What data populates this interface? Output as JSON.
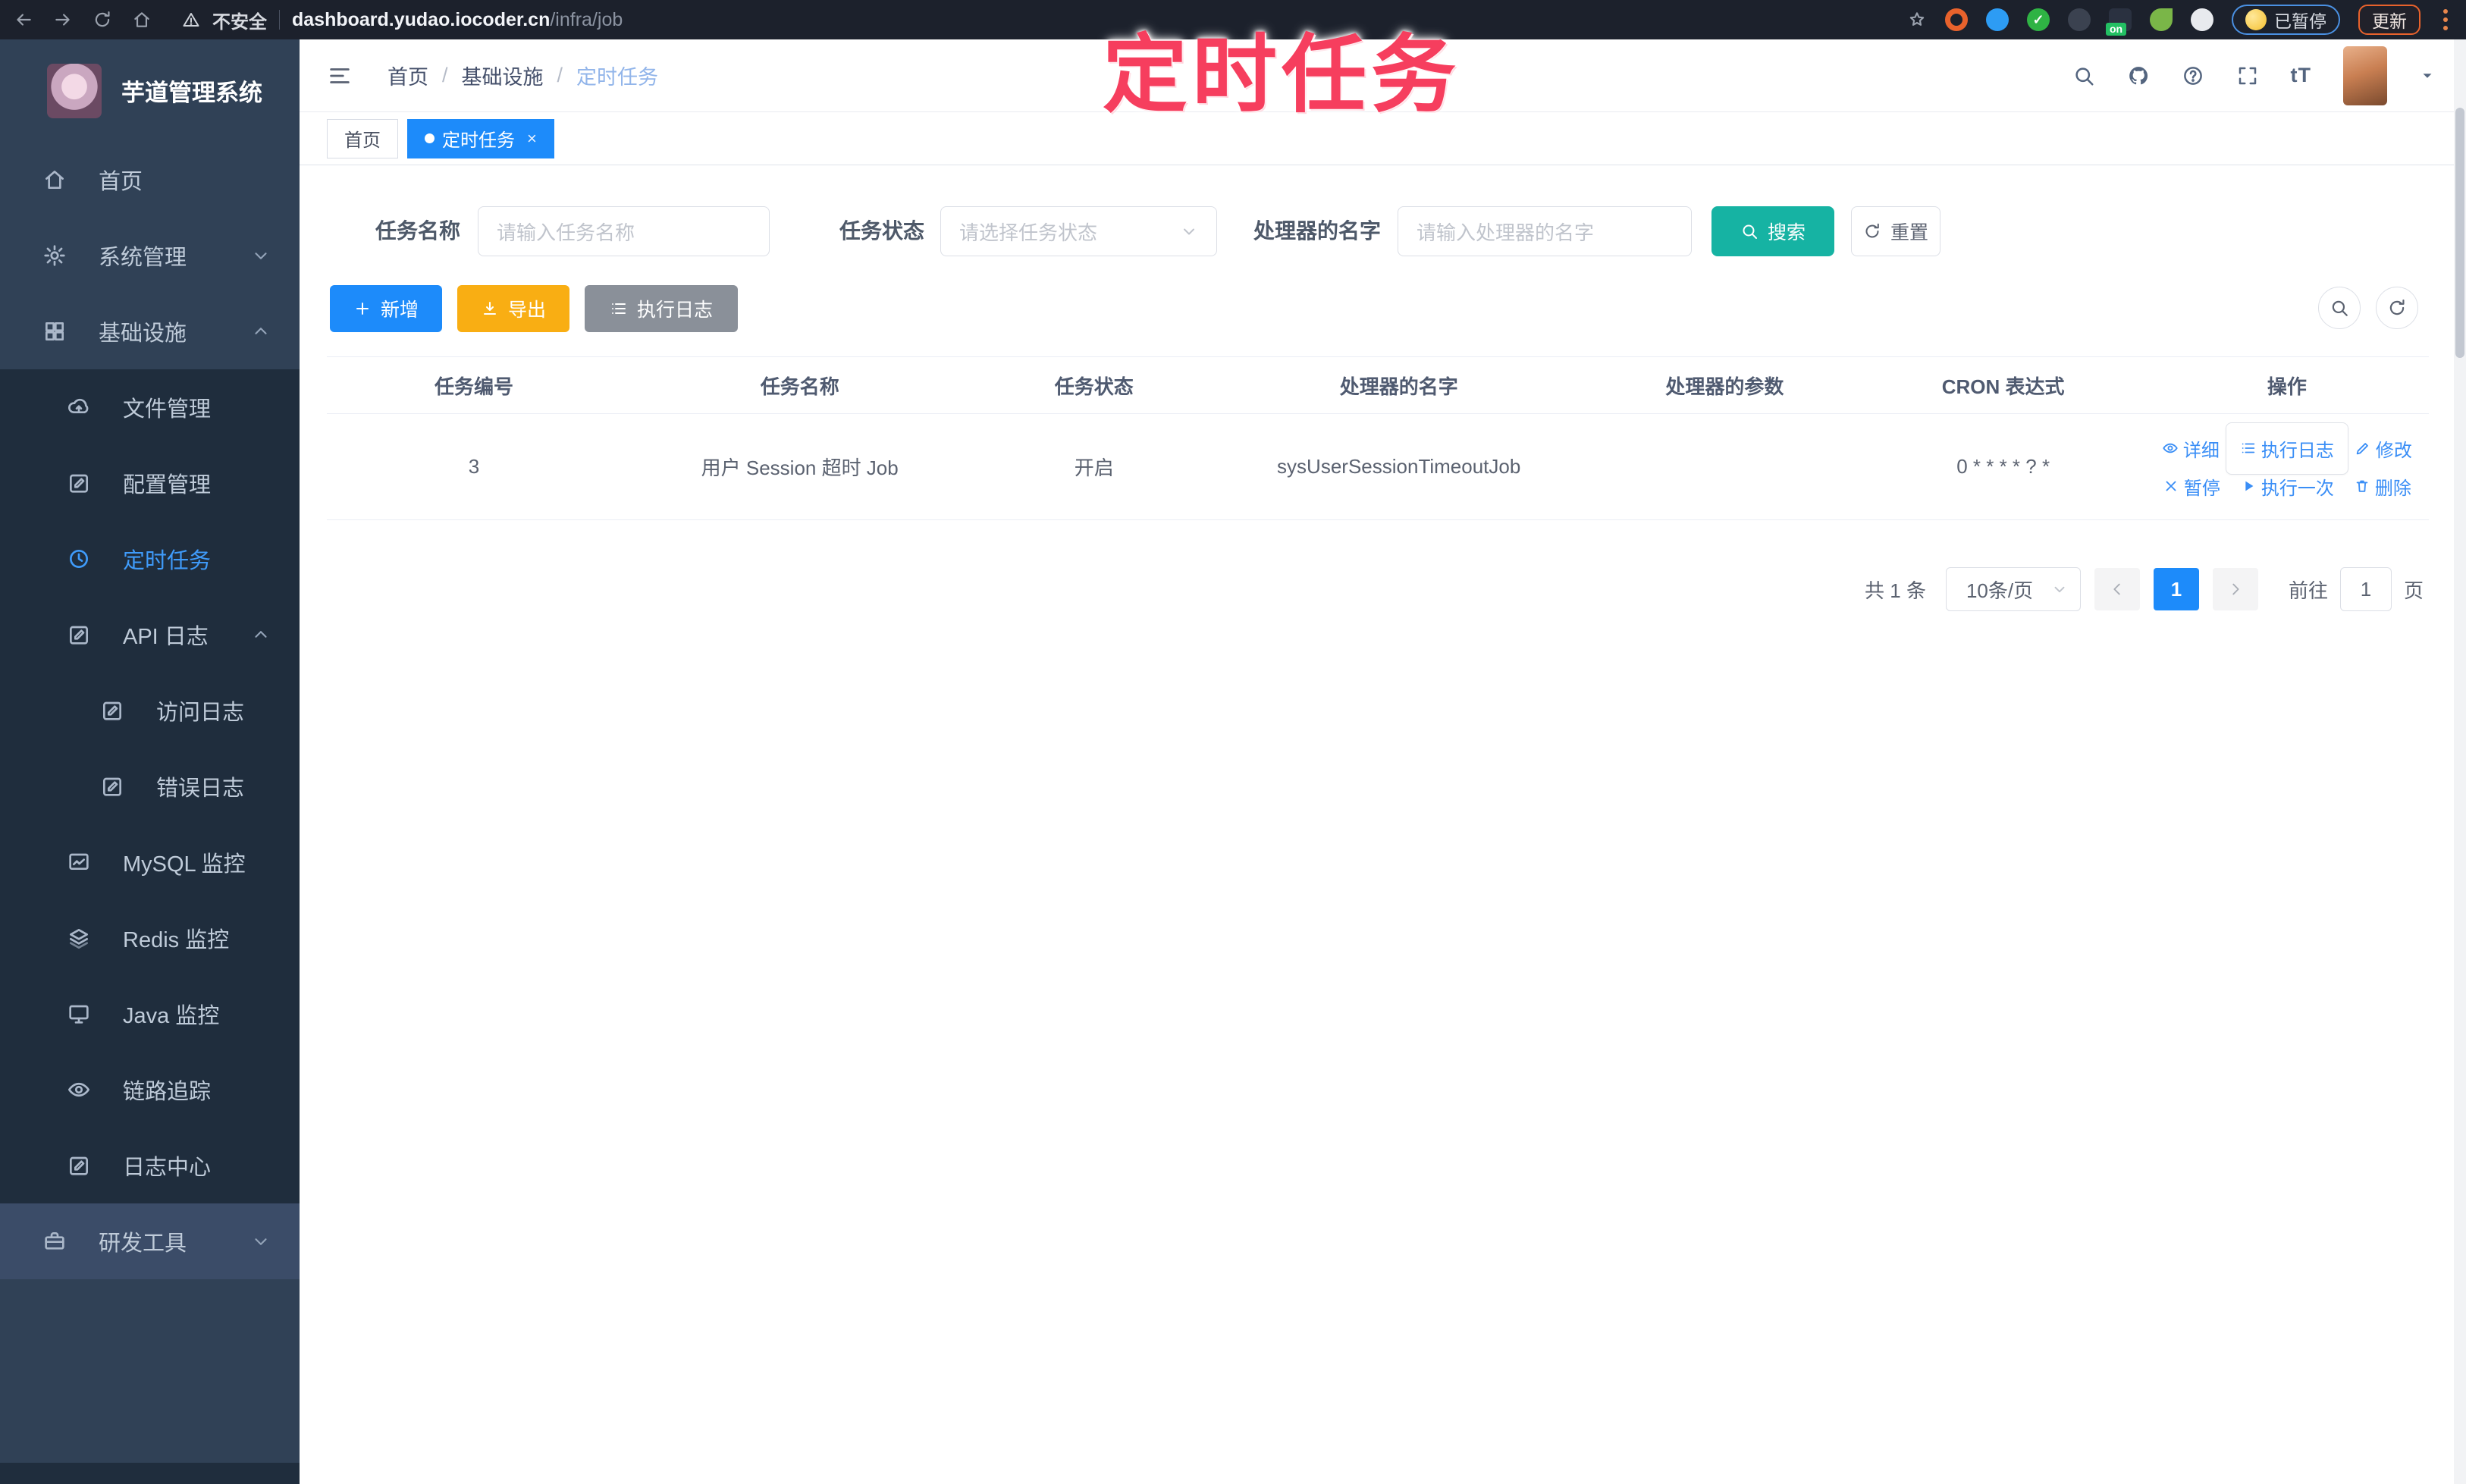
{
  "browser": {
    "security": "不安全",
    "url_domain": "dashboard.yudao.iocoder.cn",
    "url_path": "/infra/job",
    "ext_badge": "on",
    "paused_label": "已暂停",
    "update_label": "更新"
  },
  "annotation": {
    "text": "定时任务",
    "color": "#f63e5e"
  },
  "sidebar": {
    "app_title": "芋道管理系统",
    "items": [
      {
        "label": "首页"
      },
      {
        "label": "系统管理"
      },
      {
        "label": "基础设施"
      },
      {
        "label": "文件管理"
      },
      {
        "label": "配置管理"
      },
      {
        "label": "定时任务"
      },
      {
        "label": "API 日志"
      },
      {
        "label": "访问日志"
      },
      {
        "label": "错误日志"
      },
      {
        "label": "MySQL 监控"
      },
      {
        "label": "Redis 监控"
      },
      {
        "label": "Java 监控"
      },
      {
        "label": "链路追踪"
      },
      {
        "label": "日志中心"
      },
      {
        "label": "研发工具"
      }
    ]
  },
  "breadcrumb": {
    "items": [
      "首页",
      "基础设施",
      "定时任务"
    ]
  },
  "tabs": [
    {
      "label": "首页"
    },
    {
      "label": "定时任务"
    }
  ],
  "filters": {
    "name_label": "任务名称",
    "name_placeholder": "请输入任务名称",
    "status_label": "任务状态",
    "status_placeholder": "请选择任务状态",
    "handler_label": "处理器的名字",
    "handler_placeholder": "请输入处理器的名字",
    "search_label": "搜索",
    "reset_label": "重置"
  },
  "toolbar": {
    "add_label": "新增",
    "export_label": "导出",
    "exec_log_label": "执行日志"
  },
  "table": {
    "headers": [
      "任务编号",
      "任务名称",
      "任务状态",
      "处理器的名字",
      "处理器的参数",
      "CRON 表达式",
      "操作"
    ],
    "rows": [
      {
        "id": "3",
        "name": "用户 Session 超时 Job",
        "status": "开启",
        "handler": "sysUserSessionTimeoutJob",
        "params": "",
        "cron": "0 * * * * ? *",
        "actions": [
          "详细",
          "执行日志",
          "修改",
          "暂停",
          "执行一次",
          "删除"
        ]
      }
    ]
  },
  "pagination": {
    "total": "共 1 条",
    "page_size": "10条/页",
    "current": "1",
    "goto_label": "前往",
    "goto_value": "1",
    "page_label": "页"
  },
  "theme": {
    "accent_blue": "#1d8bfa",
    "link_blue": "#3a8ef6",
    "teal": "#16b3a3",
    "orange": "#f9ae13",
    "info_gray": "#8a9099",
    "sidebar_bg": "#304156",
    "submenu_bg": "#1f2d3d",
    "annotation_pink": "#f63e5e"
  }
}
